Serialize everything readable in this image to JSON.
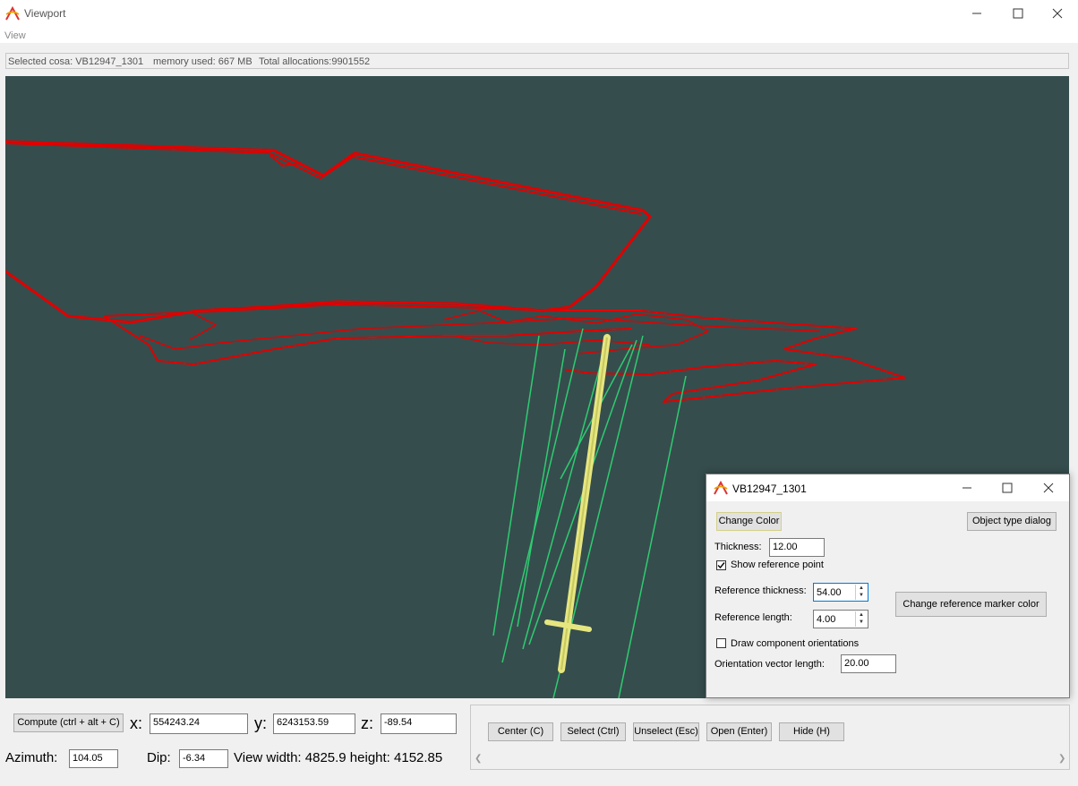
{
  "window": {
    "title": "Viewport"
  },
  "menu": {
    "items": [
      "View"
    ]
  },
  "status": {
    "selected": "Selected cosa: VB12947_1301",
    "memory": "memory used: 667 MB",
    "allocations": "Total allocations:9901552"
  },
  "controls": {
    "compute_label": "Compute (ctrl + alt + C)",
    "x_label": "x:",
    "x_value": "554243.24",
    "y_label": "y:",
    "y_value": "6243153.59",
    "z_label": "z:",
    "z_value": "-89.54",
    "azimuth_label": "Azimuth:",
    "azimuth_value": "104.05",
    "dip_label": "Dip:",
    "dip_value": "-6.34",
    "view_size": "View width: 4825.9 height: 4152.85"
  },
  "actions": {
    "center": "Center (C)",
    "select": "Select (Ctrl)",
    "unselect": "Unselect (Esc)",
    "open": "Open (Enter)",
    "hide": "Hide (H)"
  },
  "dialog": {
    "title": "VB12947_1301",
    "change_color": "Change Color",
    "object_type": "Object type dialog",
    "thickness_label": "Thickness:",
    "thickness_value": "12.00",
    "show_reference_label": "Show reference point",
    "show_reference_checked": true,
    "ref_thickness_label": "Reference thickness:",
    "ref_thickness_value": "54.00",
    "ref_length_label": "Reference length:",
    "ref_length_value": "4.00",
    "change_marker_color": "Change reference marker color",
    "draw_orientations_label": "Draw component orientations",
    "draw_orientations_checked": false,
    "orientation_length_label": "Orientation vector length:",
    "orientation_length_value": "20.00"
  },
  "colors": {
    "viewport_bg": "#364d4d",
    "tunnel": "#e00000",
    "drillholes": "#2ecc71",
    "selected_object": "#e6e680"
  },
  "icons": {
    "app": "app-logo-icon",
    "minimize": "minimize-icon",
    "maximize": "maximize-icon",
    "close": "close-icon",
    "checkbox_checked": "checkmark-icon",
    "spin": "spin-arrows-icon"
  }
}
